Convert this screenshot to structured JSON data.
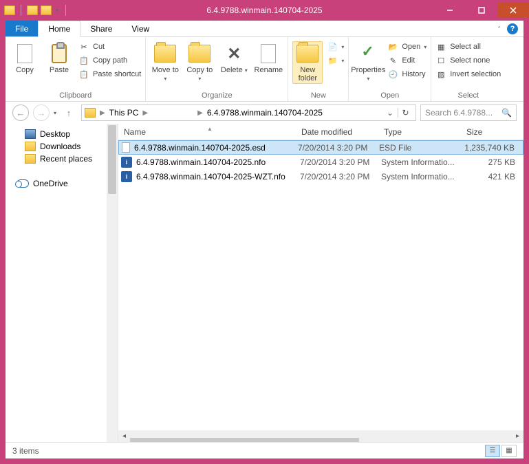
{
  "window": {
    "title": "6.4.9788.winmain.140704-2025"
  },
  "tabs": {
    "file": "File",
    "home": "Home",
    "share": "Share",
    "view": "View"
  },
  "ribbon": {
    "clipboard": {
      "label": "Clipboard",
      "copy": "Copy",
      "paste": "Paste",
      "cut": "Cut",
      "copy_path": "Copy path",
      "paste_shortcut": "Paste shortcut"
    },
    "organize": {
      "label": "Organize",
      "move_to": "Move to",
      "copy_to": "Copy to",
      "delete": "Delete",
      "rename": "Rename"
    },
    "new": {
      "label": "New",
      "new_folder": "New folder"
    },
    "open": {
      "label": "Open",
      "properties": "Properties",
      "open": "Open",
      "edit": "Edit",
      "history": "History"
    },
    "select": {
      "label": "Select",
      "select_all": "Select all",
      "select_none": "Select none",
      "invert": "Invert selection"
    }
  },
  "breadcrumb": {
    "this_pc": "This PC",
    "folder": "6.4.9788.winmain.140704-2025"
  },
  "search": {
    "placeholder": "Search 6.4.9788..."
  },
  "nav": {
    "desktop": "Desktop",
    "downloads": "Downloads",
    "recent": "Recent places",
    "onedrive": "OneDrive"
  },
  "columns": {
    "name": "Name",
    "date": "Date modified",
    "type": "Type",
    "size": "Size"
  },
  "files": [
    {
      "name": "6.4.9788.winmain.140704-2025.esd",
      "date": "7/20/2014 3:20 PM",
      "type": "ESD File",
      "size": "1,235,740 KB",
      "icon": "doc"
    },
    {
      "name": "6.4.9788.winmain.140704-2025.nfo",
      "date": "7/20/2014 3:20 PM",
      "type": "System Informatio...",
      "size": "275 KB",
      "icon": "nfo"
    },
    {
      "name": "6.4.9788.winmain.140704-2025-WZT.nfo",
      "date": "7/20/2014 3:20 PM",
      "type": "System Informatio...",
      "size": "421 KB",
      "icon": "nfo"
    }
  ],
  "status": {
    "text": "3 items"
  }
}
